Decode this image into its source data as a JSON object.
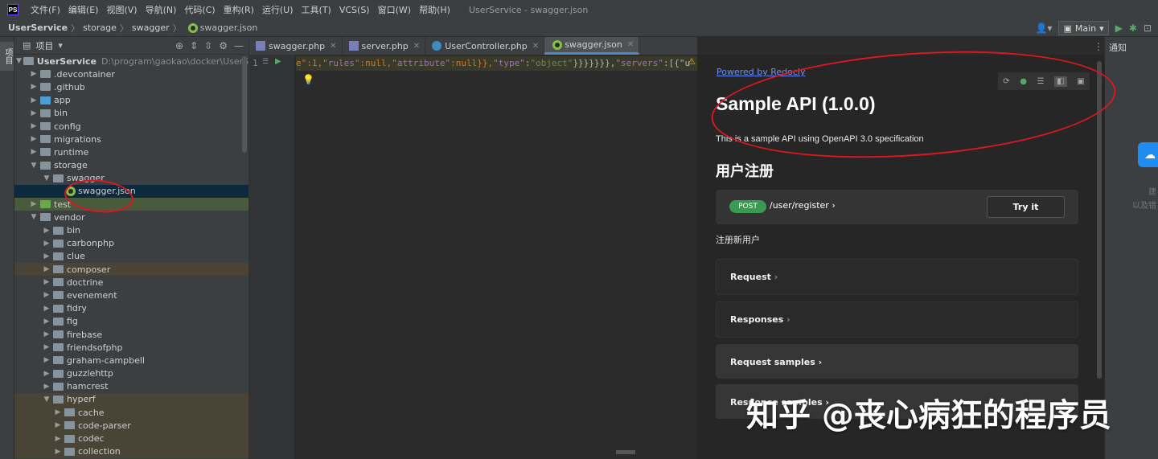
{
  "menubar": {
    "logo": "PS",
    "items": [
      "文件(F)",
      "编辑(E)",
      "视图(V)",
      "导航(N)",
      "代码(C)",
      "重构(R)",
      "运行(U)",
      "工具(T)",
      "VCS(S)",
      "窗口(W)",
      "帮助(H)"
    ],
    "window_title": "UserService - swagger.json"
  },
  "navbar": {
    "crumbs": [
      "UserService",
      "storage",
      "swagger"
    ],
    "file": "swagger.json",
    "branch": "Main"
  },
  "left_strip": {
    "tab": "项目"
  },
  "project": {
    "title": "项目",
    "root_name": "UserService",
    "root_path": "D:\\program\\gaokao\\docker\\UserService",
    "rows": [
      ".devcontainer",
      ".github",
      "app",
      "bin",
      "config",
      "migrations",
      "runtime",
      "storage",
      "swagger",
      "swagger.json",
      "test",
      "vendor",
      "bin",
      "carbonphp",
      "clue",
      "composer",
      "doctrine",
      "evenement",
      "fidry",
      "fig",
      "firebase",
      "friendsofphp",
      "graham-campbell",
      "guzzlehttp",
      "hamcrest",
      "hyperf",
      "cache",
      "code-parser",
      "codec",
      "collection"
    ]
  },
  "editor": {
    "tabs": [
      "swagger.php",
      "server.php",
      "UserController.php",
      "swagger.json"
    ],
    "line_number": "1",
    "code": {
      "t1": "e\":1,",
      "t2": "\"rules\"",
      "t3": ":null,",
      "t4": "\"attribute\"",
      "t5": ":null}},",
      "t6": "\"type\"",
      "t7": ":",
      "t8": "\"object\"",
      "t9": "}}}}}}},",
      "t10": "\"servers\"",
      "t11": ":[{\"u"
    }
  },
  "preview": {
    "powered_by": "Powered by Redocly",
    "title": "Sample API (1.0.0)",
    "description": "This is a sample API using OpenAPI 3.0 specification",
    "section": "用户注册",
    "method": "POST",
    "path": "/user/register",
    "try_it": "Try it",
    "operation_desc": "注册新用户",
    "panels": [
      "Request",
      "Responses",
      "Request samples",
      "Response samples"
    ]
  },
  "right_panel": {
    "notify": "通知",
    "hint1": "建",
    "hint2": "以及错"
  },
  "watermark": "知乎 @丧心病狂的程序员",
  "colors": {
    "accent": "#4a88c7",
    "annotation": "#d9181f",
    "post": "#3a9a53"
  }
}
